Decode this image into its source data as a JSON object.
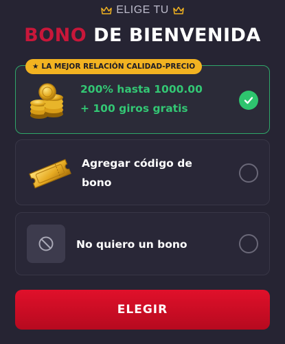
{
  "header": {
    "pretitle": "ELIGE TU",
    "title_accent": "BONO",
    "title_rest": "DE BIENVENIDA"
  },
  "options": [
    {
      "badge": "LA MEJOR RELACIÓN CALIDAD-PRECIO",
      "line1": "200% hasta 1000.00",
      "line2": "+ 100 giros gratis",
      "icon": "gold-coins-icon",
      "selected": true
    },
    {
      "line1": "Agregar código de",
      "line2": "bono",
      "icon": "ticket-icon",
      "selected": false
    },
    {
      "line1": "No quiero un bono",
      "icon": "prohibited-icon",
      "selected": false
    }
  ],
  "cta": {
    "label": "ELEGIR"
  },
  "colors": {
    "background": "#262433",
    "accent_red": "#c8173a",
    "selected_green": "#2ec46e",
    "badge_gold": "#f2b321",
    "button_red": "#d40d25"
  }
}
